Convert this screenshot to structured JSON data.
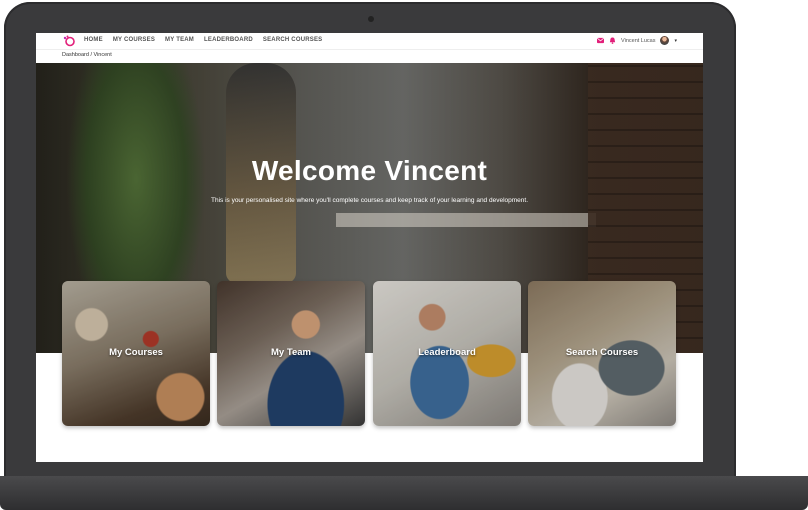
{
  "nav": {
    "links": [
      "HOME",
      "MY COURSES",
      "MY TEAM",
      "LEADERBOARD",
      "SEARCH COURSES"
    ],
    "user_name": "Vincent Lucas",
    "caret": "▾"
  },
  "breadcrumb": {
    "root": "Dashboard",
    "separator": "/",
    "current": "Vincent"
  },
  "hero": {
    "title": "Welcome Vincent",
    "subtitle": "This is your personalised site where you'll complete courses and keep track of your learning and development."
  },
  "cards": [
    {
      "label": "My Courses"
    },
    {
      "label": "My Team"
    },
    {
      "label": "Leaderboard"
    },
    {
      "label": "Search Courses"
    }
  ],
  "colors": {
    "accent": "#e2207a",
    "brand": "#c02cb0"
  },
  "icons": [
    "logo-icon",
    "mail-icon",
    "bell-icon",
    "avatar",
    "chevron-down-icon"
  ]
}
